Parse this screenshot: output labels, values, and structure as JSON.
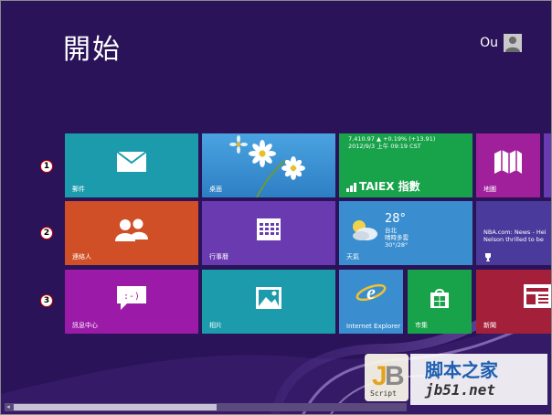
{
  "start": {
    "title": "開始"
  },
  "user": {
    "name": "Ou"
  },
  "markers": [
    "1",
    "2",
    "3"
  ],
  "tiles": {
    "mail": {
      "label": "郵件",
      "color": "#1b9bab"
    },
    "desktop": {
      "label": "桌面",
      "color": "#3a8ecf"
    },
    "finance": {
      "line1": "7,410.97 ▲ +0.19% (+13.91)",
      "line2": "2012/9/3 上午 09:19 CST",
      "name": "TAIEX 指數",
      "color": "#18a34a"
    },
    "maps": {
      "label": "地圖",
      "color": "#a0209b"
    },
    "people": {
      "label": "連絡人",
      "color": "#d04f26"
    },
    "calendar": {
      "label": "行事曆",
      "color": "#6a3bb0"
    },
    "weather": {
      "temp": "28°",
      "city": "台北",
      "condition": "晴時多雲",
      "range": "30°/28°",
      "label": "天氣",
      "color": "#3a8ecf"
    },
    "sports": {
      "line1": "NBA.com: News - Hei",
      "line2": "Nelson thrilled to be",
      "color": "#4a3a9c"
    },
    "messaging": {
      "label": "訊息中心",
      "color": "#9c1aa8"
    },
    "photos": {
      "label": "相片",
      "color": "#1b9bab"
    },
    "ie": {
      "label": "Internet Explorer",
      "color": "#3a8ecf"
    },
    "store": {
      "label": "市集",
      "color": "#18a34a"
    },
    "news": {
      "label": "新聞",
      "color": "#a4203a"
    }
  },
  "watermark": {
    "brand": "脚本之家",
    "site": "jb51.net",
    "script": "Script"
  }
}
